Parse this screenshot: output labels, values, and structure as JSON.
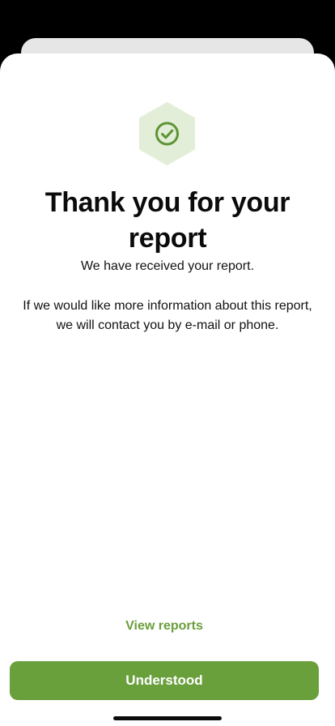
{
  "success": {
    "icon": "check-circle-icon",
    "title": "Thank you for your report",
    "subtitle": "We have received your report.",
    "body": "If we would like more information about this report, we will contact you by e-mail or phone."
  },
  "actions": {
    "view_reports_label": "View reports",
    "understood_label": "Understood"
  },
  "colors": {
    "accent": "#6aa03c",
    "badge_bg": "#e3eed8",
    "background": "#000000"
  }
}
